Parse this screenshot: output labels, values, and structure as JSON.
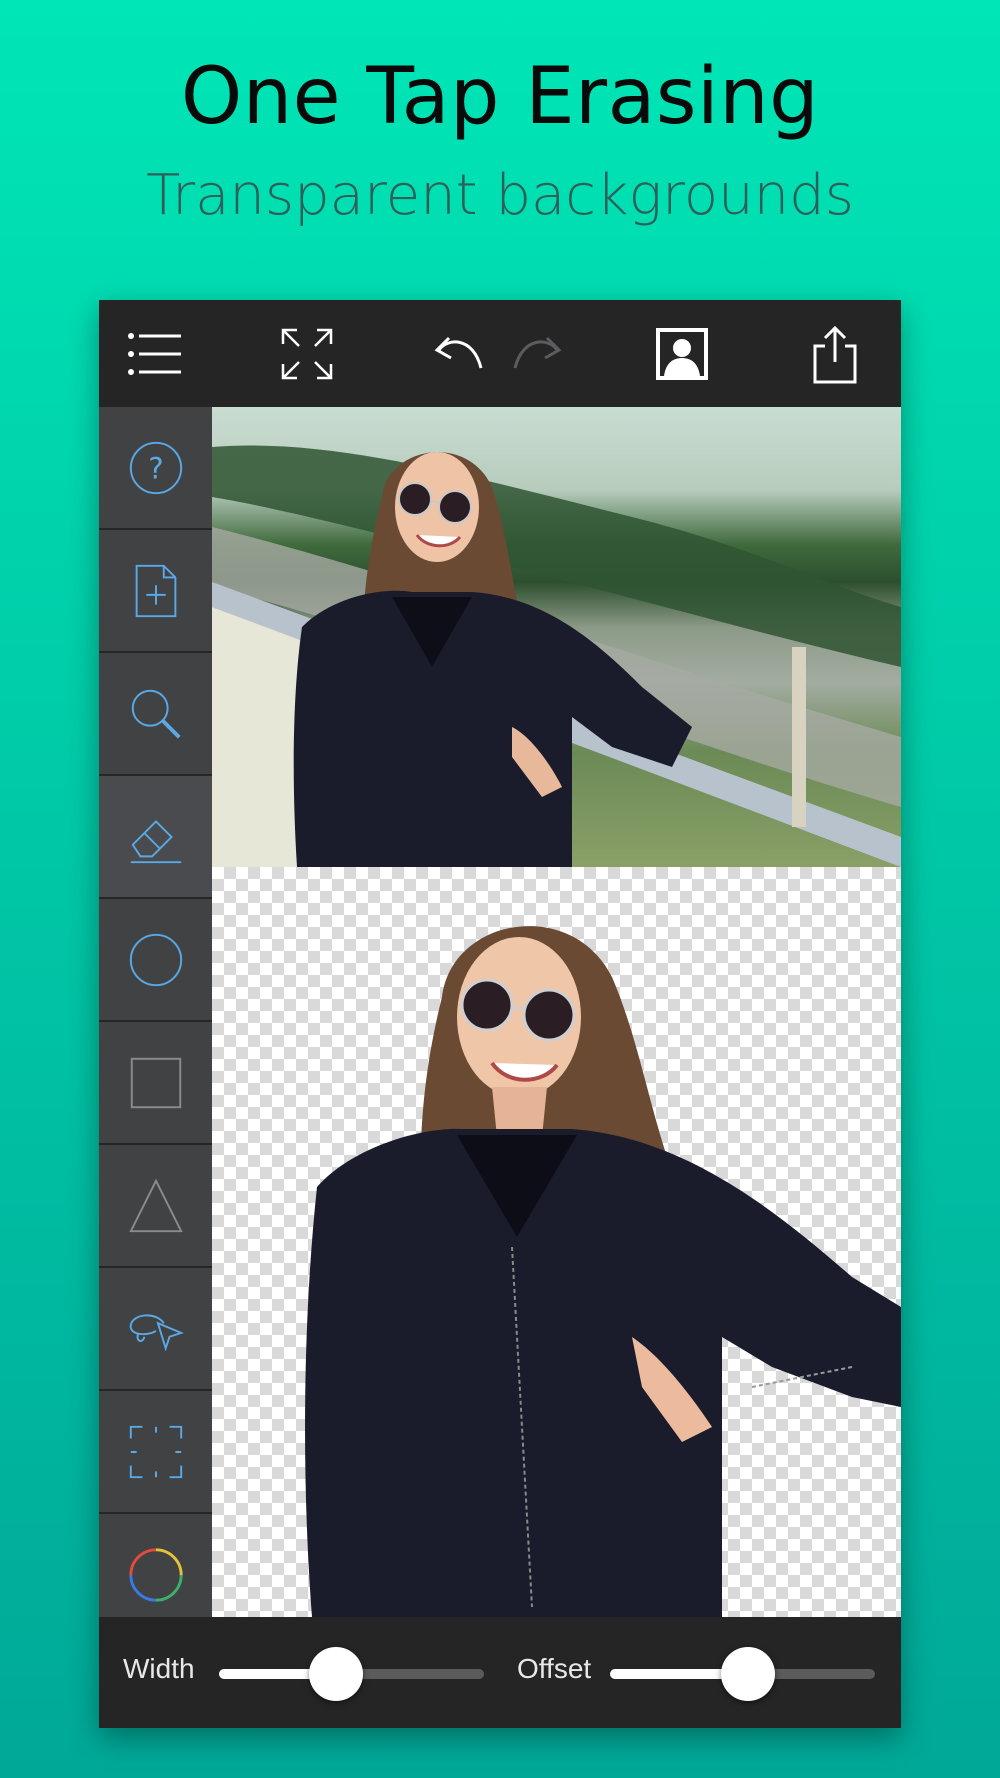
{
  "headline": "One Tap Erasing",
  "subheadline": "Transparent backgrounds",
  "colors": {
    "accent": "#5aa9e6",
    "toolbar": "#252526",
    "sidebar": "#414244",
    "background_top": "#00e6b6",
    "background_bottom": "#00a898"
  },
  "toolbar": {
    "icons": [
      "menu-icon",
      "fullscreen-icon",
      "undo-icon",
      "redo-icon",
      "portrait-icon",
      "share-icon"
    ]
  },
  "sidebar": {
    "tools": [
      "help-icon",
      "new-file-icon",
      "zoom-icon",
      "eraser-icon",
      "circle-icon",
      "square-icon",
      "triangle-icon",
      "lasso-icon",
      "crop-icon",
      "color-wheel-icon"
    ],
    "active_tool": "eraser-icon"
  },
  "sliders": {
    "width_label": "Width",
    "width_value": 0.44,
    "offset_label": "Offset",
    "offset_value": 0.52
  }
}
